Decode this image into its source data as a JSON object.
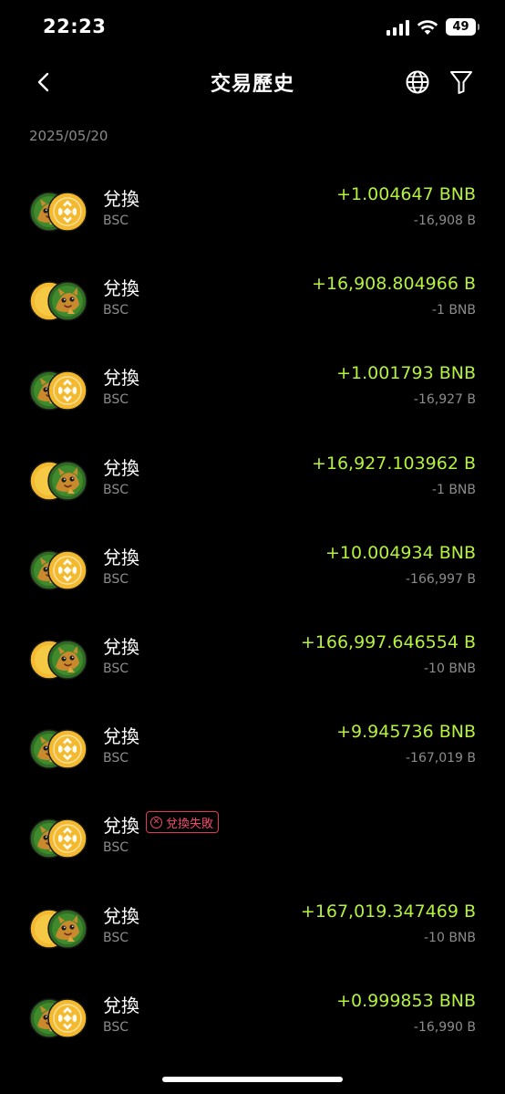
{
  "status_bar": {
    "time": "22:23",
    "battery": "49"
  },
  "header": {
    "title": "交易歷史"
  },
  "date": "2025/05/20",
  "transactions": [
    {
      "type": "兌換",
      "chain": "BSC",
      "primary": "+1.004647 BNB",
      "secondary": "-16,908 B",
      "front_coin": "bnb-coin-icon",
      "back_coin": "cat-coin-icon",
      "status": ""
    },
    {
      "type": "兌換",
      "chain": "BSC",
      "primary": "+16,908.804966 B",
      "secondary": "-1 BNB",
      "front_coin": "cat-coin-icon",
      "back_coin": "yellow-coin-icon",
      "status": ""
    },
    {
      "type": "兌換",
      "chain": "BSC",
      "primary": "+1.001793 BNB",
      "secondary": "-16,927 B",
      "front_coin": "bnb-coin-icon",
      "back_coin": "cat-coin-icon",
      "status": ""
    },
    {
      "type": "兌換",
      "chain": "BSC",
      "primary": "+16,927.103962 B",
      "secondary": "-1 BNB",
      "front_coin": "cat-coin-icon",
      "back_coin": "yellow-coin-icon",
      "status": ""
    },
    {
      "type": "兌換",
      "chain": "BSC",
      "primary": "+10.004934 BNB",
      "secondary": "-166,997 B",
      "front_coin": "bnb-coin-icon",
      "back_coin": "cat-coin-icon",
      "status": ""
    },
    {
      "type": "兌換",
      "chain": "BSC",
      "primary": "+166,997.646554 B",
      "secondary": "-10 BNB",
      "front_coin": "cat-coin-icon",
      "back_coin": "yellow-coin-icon",
      "status": ""
    },
    {
      "type": "兌換",
      "chain": "BSC",
      "primary": "+9.945736 BNB",
      "secondary": "-167,019 B",
      "front_coin": "bnb-coin-icon",
      "back_coin": "cat-coin-icon",
      "status": ""
    },
    {
      "type": "兌換",
      "chain": "BSC",
      "primary": "",
      "secondary": "",
      "front_coin": "bnb-coin-icon",
      "back_coin": "cat-coin-icon",
      "status": "兌換失敗"
    },
    {
      "type": "兌換",
      "chain": "BSC",
      "primary": "+167,019.347469 B",
      "secondary": "-10 BNB",
      "front_coin": "cat-coin-icon",
      "back_coin": "yellow-coin-icon",
      "status": ""
    },
    {
      "type": "兌換",
      "chain": "BSC",
      "primary": "+0.999853 BNB",
      "secondary": "-16,990 B",
      "front_coin": "bnb-coin-icon",
      "back_coin": "cat-coin-icon",
      "status": ""
    }
  ],
  "colors": {
    "positive": "#b5f23d",
    "muted": "#8c8c8c",
    "fail": "#f04a6c",
    "bnb": "#f3ba2f"
  }
}
